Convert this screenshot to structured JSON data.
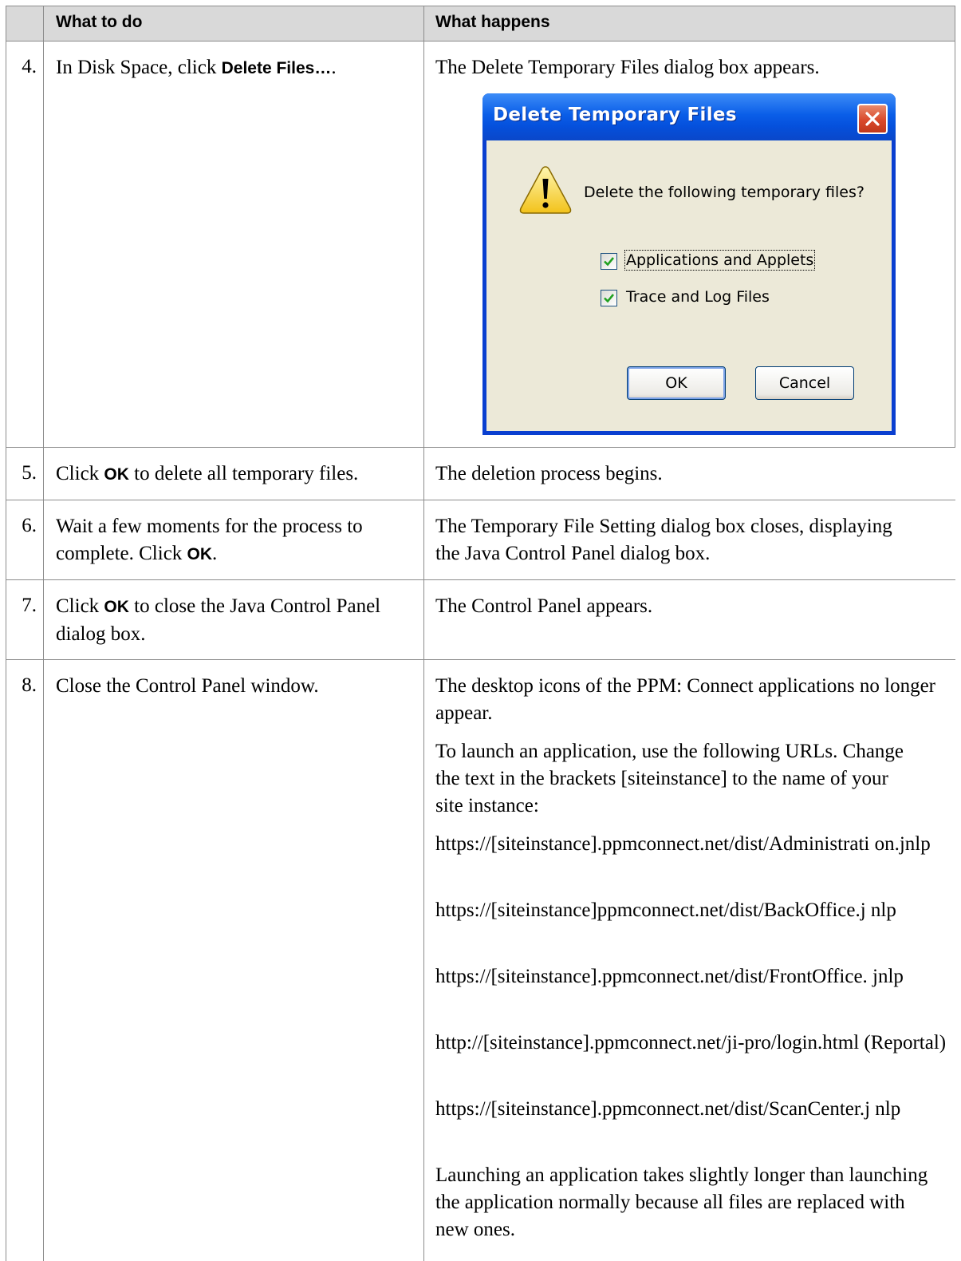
{
  "table": {
    "headers": {
      "col_do": "What to do",
      "col_happens": "What happens"
    },
    "rows": [
      {
        "num": "4.",
        "do_prefix": "In Disk Space, click ",
        "do_bold": "Delete Files…",
        "do_suffix": ".",
        "happens": "The Delete Temporary Files dialog box appears."
      },
      {
        "num": "5.",
        "do_prefix": "Click ",
        "do_bold": "OK",
        "do_suffix": " to delete all temporary files.",
        "happens": "The deletion process begins."
      },
      {
        "num": "6.",
        "do_prefix": "Wait a few moments for the process to complete. Click ",
        "do_bold": "OK",
        "do_suffix": ".",
        "happens": "The Temporary File Setting dialog box closes, displaying the Java Control Panel dialog box."
      },
      {
        "num": "7.",
        "do_prefix": "Click ",
        "do_bold": "OK",
        "do_suffix": " to close the Java Control Panel dialog box.",
        "happens": "The Control Panel appears."
      },
      {
        "num": "8.",
        "do_text": "Close the Control Panel window.",
        "happens_paragraphs": [
          "The desktop icons of the PPM: Connect applications no longer appear.",
          "To launch an application, use the following URLs. Change the text in the brackets [siteinstance] to the name of your site instance:",
          "https://[siteinstance].ppmconnect.net/dist/Administrati on.jnlp",
          "https://[siteinstance]ppmconnect.net/dist/BackOffice.j nlp",
          "https://[siteinstance].ppmconnect.net/dist/FrontOffice. jnlp",
          "http://[siteinstance].ppmconnect.net/ji-pro/login.html (Reportal)",
          "https://[siteinstance].ppmconnect.net/dist/ScanCenter.j nlp",
          "Launching an application takes slightly longer than launching the application normally because all files are replaced with new ones."
        ]
      }
    ]
  },
  "dialog": {
    "title": "Delete Temporary Files",
    "message": "Delete the following temporary files?",
    "checkboxes": [
      {
        "label": "Applications and Applets",
        "checked": true
      },
      {
        "label": "Trace and Log Files",
        "checked": true
      }
    ],
    "ok_label": "OK",
    "cancel_label": "Cancel",
    "icons": {
      "warning": "warning-icon",
      "close": "close-icon",
      "check": "checkmark-icon"
    },
    "colors": {
      "title_bar": "#0a5ee8",
      "body": "#ece9d8",
      "close_button": "#d9492b"
    }
  }
}
